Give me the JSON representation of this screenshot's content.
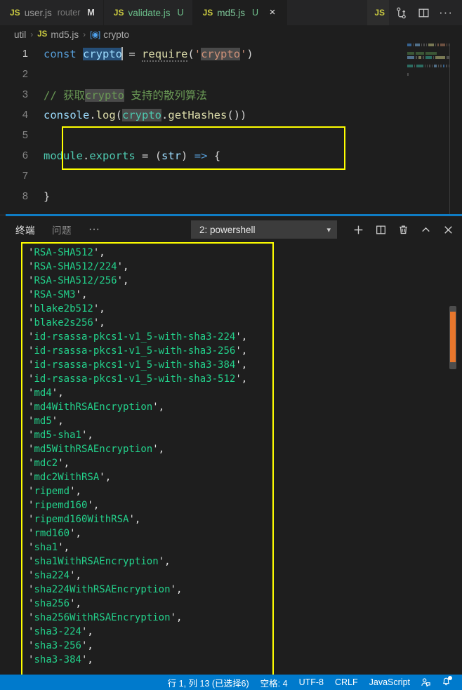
{
  "window": {
    "background": "#1e1e1e",
    "accent": "#007acc",
    "highlight": "#ffff00"
  },
  "tabs": [
    {
      "icon": "js-file-icon",
      "name": "user.js",
      "description": "router",
      "status": "M",
      "active": false
    },
    {
      "icon": "js-file-icon",
      "name": "validate.js",
      "description": "",
      "status": "U",
      "active": false
    },
    {
      "icon": "js-file-icon",
      "name": "md5.js",
      "description": "",
      "status": "U",
      "active": true,
      "close": "×"
    }
  ],
  "tab_actions": [
    {
      "name": "source-control-icon",
      "label": ""
    },
    {
      "name": "split-editor-icon",
      "label": ""
    },
    {
      "name": "more-actions-icon",
      "label": "···"
    }
  ],
  "breadcrumb": {
    "separator": "›",
    "items": [
      {
        "icon": "",
        "label": "util"
      },
      {
        "icon": "js-file-icon",
        "label": "md5.js"
      },
      {
        "icon": "symbol-variable-icon",
        "label": "crypto"
      }
    ]
  },
  "editor": {
    "language": "JavaScript",
    "selected_word": "crypto",
    "lines": [
      {
        "num": "1",
        "current": true,
        "tokens": [
          {
            "t": "const",
            "c": "k-kw"
          },
          {
            "t": " ",
            "c": "k-punc"
          },
          {
            "t": "crypto",
            "c": "k-var sel-blue"
          },
          {
            "t": "CARET",
            "c": "caret"
          },
          {
            "t": " ",
            "c": "k-punc"
          },
          {
            "t": "=",
            "c": "k-punc"
          },
          {
            "t": " ",
            "c": "k-punc"
          },
          {
            "t": "require",
            "c": "k-fn squiggle"
          },
          {
            "t": "(",
            "c": "k-punc"
          },
          {
            "t": "'",
            "c": "k-str"
          },
          {
            "t": "crypto",
            "c": "k-str sel-grey"
          },
          {
            "t": "'",
            "c": "k-str"
          },
          {
            "t": ")",
            "c": "k-punc"
          }
        ]
      },
      {
        "num": "2",
        "current": false,
        "tokens": []
      },
      {
        "num": "3",
        "current": false,
        "tokens": [
          {
            "t": "// 获取",
            "c": "k-cmt"
          },
          {
            "t": "crypto",
            "c": "k-cmt sel-grey"
          },
          {
            "t": " 支持的散列算法",
            "c": "k-cmt"
          }
        ]
      },
      {
        "num": "4",
        "current": false,
        "tokens": [
          {
            "t": "console",
            "c": "k-var"
          },
          {
            "t": ".",
            "c": "k-punc"
          },
          {
            "t": "log",
            "c": "k-fn"
          },
          {
            "t": "(",
            "c": "k-punc"
          },
          {
            "t": "crypto",
            "c": "k-teal sel-grey"
          },
          {
            "t": ".",
            "c": "k-punc"
          },
          {
            "t": "getHashes",
            "c": "k-fn"
          },
          {
            "t": "())",
            "c": "k-punc"
          }
        ]
      },
      {
        "num": "5",
        "current": false,
        "tokens": []
      },
      {
        "num": "6",
        "current": false,
        "tokens": [
          {
            "t": "module",
            "c": "k-teal"
          },
          {
            "t": ".",
            "c": "k-punc"
          },
          {
            "t": "exports",
            "c": "k-teal"
          },
          {
            "t": " ",
            "c": "k-punc"
          },
          {
            "t": "=",
            "c": "k-punc"
          },
          {
            "t": " ",
            "c": "k-punc"
          },
          {
            "t": "(",
            "c": "k-punc"
          },
          {
            "t": "str",
            "c": "k-var"
          },
          {
            "t": ")",
            "c": "k-punc"
          },
          {
            "t": " ",
            "c": "k-punc"
          },
          {
            "t": "=>",
            "c": "k-arrow"
          },
          {
            "t": " ",
            "c": "k-punc"
          },
          {
            "t": "{",
            "c": "k-punc"
          }
        ]
      },
      {
        "num": "7",
        "current": false,
        "tokens": []
      },
      {
        "num": "8",
        "current": false,
        "tokens": [
          {
            "t": "}",
            "c": "k-punc"
          }
        ]
      }
    ]
  },
  "panel": {
    "tabs": [
      {
        "label": "终端",
        "active": true
      },
      {
        "label": "问题",
        "active": false
      }
    ],
    "more_label": "···",
    "terminal_select": {
      "value": "2: powershell",
      "chevron": "⌄"
    },
    "actions": [
      {
        "name": "new-terminal-icon"
      },
      {
        "name": "split-terminal-icon"
      },
      {
        "name": "kill-terminal-icon"
      },
      {
        "name": "maximize-panel-icon"
      },
      {
        "name": "close-panel-icon"
      }
    ]
  },
  "terminal": {
    "lines": [
      "'RSA-SHA512',",
      "'RSA-SHA512/224',",
      "'RSA-SHA512/256',",
      "'RSA-SM3',",
      "'blake2b512',",
      "'blake2s256',",
      "'id-rsassa-pkcs1-v1_5-with-sha3-224',",
      "'id-rsassa-pkcs1-v1_5-with-sha3-256',",
      "'id-rsassa-pkcs1-v1_5-with-sha3-384',",
      "'id-rsassa-pkcs1-v1_5-with-sha3-512',",
      "'md4',",
      "'md4WithRSAEncryption',",
      "'md5',",
      "'md5-sha1',",
      "'md5WithRSAEncryption',",
      "'mdc2',",
      "'mdc2WithRSA',",
      "'ripemd',",
      "'ripemd160',",
      "'ripemd160WithRSA',",
      "'rmd160',",
      "'sha1',",
      "'sha1WithRSAEncryption',",
      "'sha224',",
      "'sha224WithRSAEncryption',",
      "'sha256',",
      "'sha256WithRSAEncryption',",
      "'sha3-224',",
      "'sha3-256',",
      "'sha3-384',"
    ]
  },
  "statusbar": {
    "items": [
      {
        "name": "cursor-position",
        "label": "行 1, 列 13 (已选择6)"
      },
      {
        "name": "indentation",
        "label": "空格: 4"
      },
      {
        "name": "encoding",
        "label": "UTF-8"
      },
      {
        "name": "eol",
        "label": "CRLF"
      },
      {
        "name": "language-mode",
        "label": "JavaScript"
      }
    ],
    "icons": [
      {
        "name": "live-share-icon"
      },
      {
        "name": "notifications-bell-icon"
      }
    ]
  }
}
